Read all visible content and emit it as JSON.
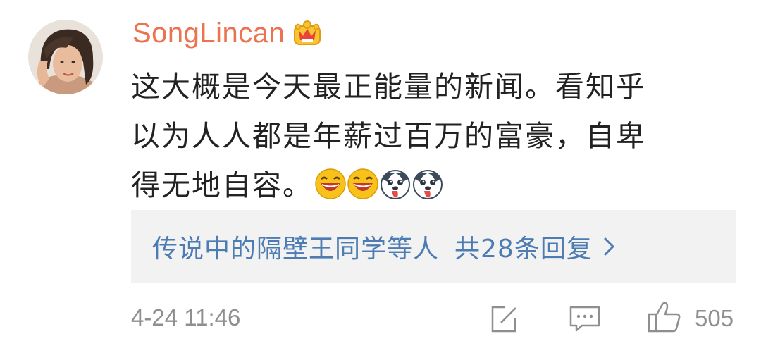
{
  "comment": {
    "username": "SongLincan",
    "badge_icon": "vip-crown-icon",
    "text_line1": "这大概是今天最正能量的新闻。看知乎",
    "text_line2": "以为人人都是年薪过百万的富豪，自卑",
    "text_line3": "得无地自容。",
    "emojis": [
      "laughing-emoji-icon",
      "laughing-emoji-icon",
      "husky-dog-emoji-icon",
      "husky-dog-emoji-icon"
    ],
    "timestamp": "4-24 11:46",
    "likes": "505"
  },
  "replies": {
    "summary": "传说中的隔壁王同学等人",
    "count_label": "共28条回复",
    "chevron_icon": "chevron-right-icon"
  },
  "actions": {
    "edit_icon": "edit-icon",
    "reply_icon": "comment-icon",
    "like_icon": "thumbs-up-icon"
  },
  "colors": {
    "username": "#eb7350",
    "link": "#4d7cb3",
    "meta": "#8f8f8f",
    "reply_bg": "#f2f2f2"
  }
}
